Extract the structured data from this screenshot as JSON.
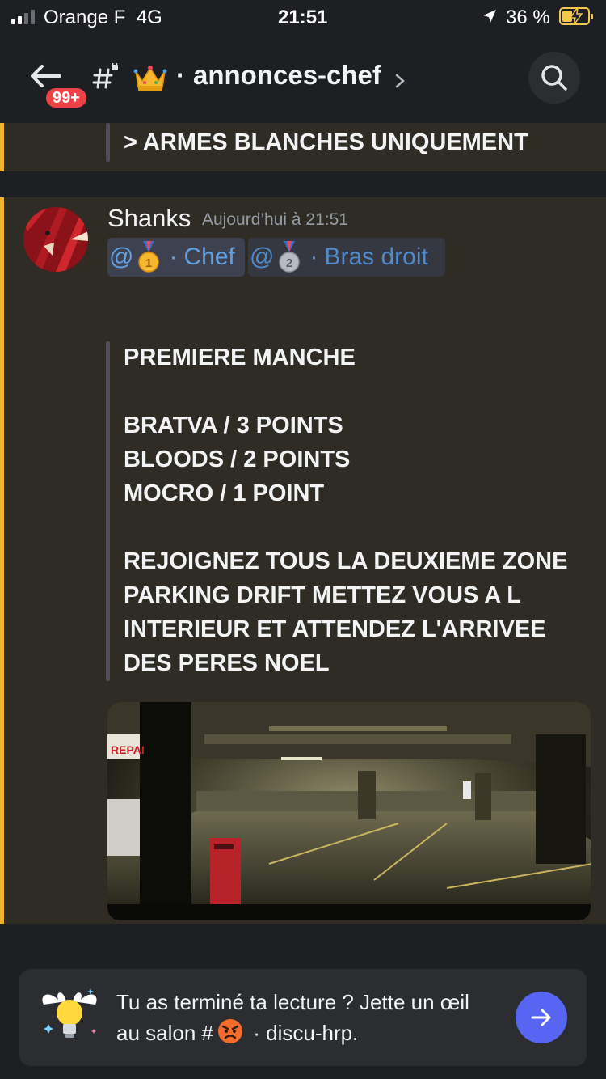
{
  "status_bar": {
    "carrier": "Orange F",
    "network": "4G",
    "time": "21:51",
    "battery_percent": "36 %",
    "battery_level": 0.36
  },
  "header": {
    "unread_badge": "99+",
    "channel_separator": "·",
    "channel_name": "annonces-chef",
    "icons": [
      "back-arrow-icon",
      "hash-lock-icon",
      "crown-icon",
      "chevron-right-icon",
      "search-icon"
    ]
  },
  "previous_message": {
    "quote_text": "> ARMES BLANCHES UNIQUEMENT"
  },
  "message": {
    "author": "Shanks",
    "timestamp": "Aujourd’hui à 21:51",
    "mentions": [
      {
        "at": "@",
        "medal": "gold-medal-icon",
        "sep": "·",
        "label": "Chef"
      },
      {
        "at": "@",
        "medal": "silver-medal-icon",
        "sep": "·",
        "label": "Bras droit"
      }
    ],
    "quote_lines": [
      "PREMIERE MANCHE",
      "",
      "BRATVA / 3 POINTS",
      "BLOODS / 2 POINTS",
      "MOCRO / 1 POINT",
      "",
      "REJOIGNEZ TOUS LA DEUXIEME ZONE",
      "PARKING DRIFT METTEZ VOUS A L",
      "INTERIEUR ET ATTENDEZ L'ARRIVEE",
      "DES PERES NOEL"
    ]
  },
  "read_prompt": {
    "line1": "Tu as terminé ta lecture ? Jette un œil",
    "line2_prefix": "au salon #",
    "line2_sep": "·",
    "line2_channel": "discu-hrp."
  },
  "colors": {
    "accent_highlight": "#f0b232",
    "mention_text": "#5fa1e3",
    "badge_red": "#ed4245",
    "blurple": "#5865f2"
  }
}
